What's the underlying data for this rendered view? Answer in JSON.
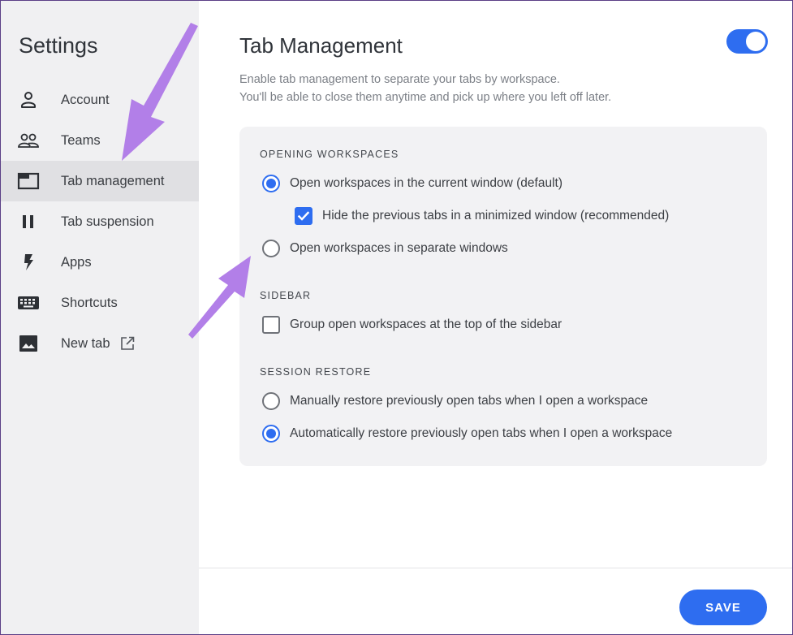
{
  "sidebar": {
    "title": "Settings",
    "items": [
      {
        "label": "Account",
        "icon": "person-icon",
        "active": false
      },
      {
        "label": "Teams",
        "icon": "people-icon",
        "active": false
      },
      {
        "label": "Tab management",
        "icon": "tab-window-icon",
        "active": true
      },
      {
        "label": "Tab suspension",
        "icon": "pause-icon",
        "active": false
      },
      {
        "label": "Apps",
        "icon": "lightning-icon",
        "active": false
      },
      {
        "label": "Shortcuts",
        "icon": "keyboard-icon",
        "active": false
      },
      {
        "label": "New tab",
        "icon": "image-icon",
        "active": false
      }
    ]
  },
  "main": {
    "title": "Tab Management",
    "description_line1": "Enable tab management to separate your tabs by workspace.",
    "description_line2": "You'll be able to close them anytime and pick up where you left off later.",
    "toggle_on": true,
    "sections": {
      "opening": {
        "header": "OPENING WORKSPACES",
        "option_current": "Open workspaces in the current window (default)",
        "option_hide": "Hide the previous tabs in a minimized window (recommended)",
        "option_separate": "Open workspaces in separate windows"
      },
      "sidebar": {
        "header": "SIDEBAR",
        "option_group": "Group open workspaces at the top of the sidebar"
      },
      "session": {
        "header": "SESSION RESTORE",
        "option_manual": "Manually restore previously open tabs when I open a workspace",
        "option_auto": "Automatically restore previously open tabs when I open a workspace"
      }
    },
    "save_label": "SAVE"
  },
  "colors": {
    "accent": "#2e6df0",
    "annotation_arrow": "#b27fe8",
    "sidebar_bg": "#f0f0f2"
  }
}
